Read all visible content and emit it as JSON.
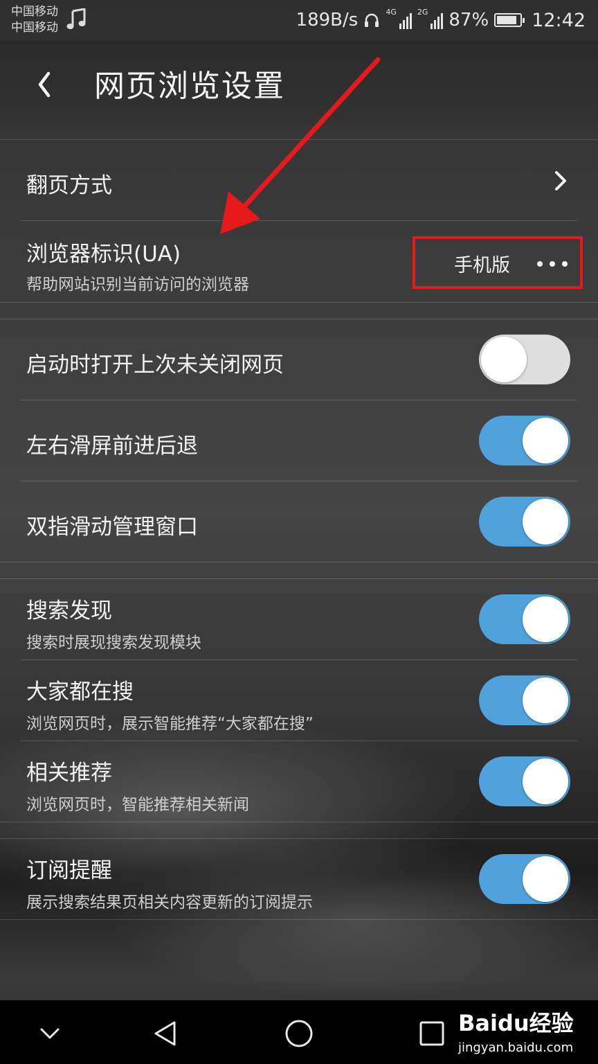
{
  "status_bar": {
    "carrier_1": "中国移动",
    "carrier_2": "中国移动",
    "net_speed": "189B/s",
    "net_4g": "4G",
    "net_2g": "2G",
    "battery": "87%",
    "battery_level": 0.87,
    "time": "12:42",
    "icons": [
      "music-note-icon",
      "headset-icon",
      "signal-icon",
      "battery-icon"
    ]
  },
  "header": {
    "title": "网页浏览设置",
    "back_icon": "chevron-left-icon"
  },
  "section1": {
    "page_turn": {
      "label": "翻页方式",
      "icon": "chevron-right-icon"
    },
    "ua": {
      "label": "浏览器标识(UA)",
      "description": "帮助网站识别当前访问的浏览器",
      "value": "手机版",
      "icon": "more-dots-icon"
    }
  },
  "section2": [
    {
      "label": "启动时打开上次未关闭网页",
      "on": false
    },
    {
      "label": "左右滑屏前进后退",
      "on": true
    },
    {
      "label": "双指滑动管理窗口",
      "on": true
    }
  ],
  "section3": [
    {
      "label": "搜索发现",
      "description": "搜索时展现搜索发现模块",
      "on": true
    },
    {
      "label": "大家都在搜",
      "description": "浏览网页时，展示智能推荐“大家都在搜”",
      "on": true
    },
    {
      "label": "相关推荐",
      "description": "浏览网页时，智能推荐相关新闻",
      "on": true
    }
  ],
  "section4": [
    {
      "label": "订阅提醒",
      "description": "展示搜索结果页相关内容更新的订阅提示",
      "on": true
    }
  ],
  "annotation": {
    "highlight_color": "#e51a1a"
  },
  "toggle_color": "#4fa2dc",
  "nav_bar": {
    "icons": [
      "chevron-down-icon",
      "back-triangle-icon",
      "home-circle-icon",
      "recents-square-icon"
    ]
  },
  "watermark": {
    "brand": "Baidu经验",
    "url": "jingyan.baidu.com"
  }
}
